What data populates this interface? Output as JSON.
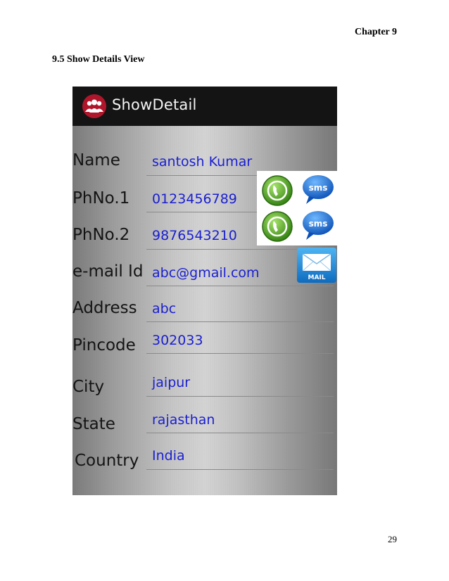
{
  "header": {
    "chapter": "Chapter 9",
    "section": "9.5 Show Details View"
  },
  "footer": {
    "page_number": "29"
  },
  "app": {
    "title": "ShowDetail",
    "fields": [
      {
        "label": "Name",
        "value": "santosh Kumar"
      },
      {
        "label": "PhNo.1",
        "value": "0123456789"
      },
      {
        "label": "PhNo.2",
        "value": "9876543210"
      },
      {
        "label": "e-mail Id",
        "value": "abc@gmail.com"
      },
      {
        "label": "Address",
        "value": "abc"
      },
      {
        "label": "Pincode",
        "value": "302033"
      },
      {
        "label": "City",
        "value": "jaipur"
      },
      {
        "label": "State",
        "value": "rajasthan"
      },
      {
        "label": "Country",
        "value": "India"
      }
    ],
    "actions": {
      "sms_label": "sms",
      "mail_label": "MAIL"
    }
  },
  "colors": {
    "action_bar": "#141414",
    "value_text": "#1a1fd0",
    "call_green": "#4aa31c",
    "sms_blue": "#1273d6",
    "mail_blue": "#1f8fdb",
    "app_icon_red": "#b0162b"
  },
  "icons": [
    "app-users-icon",
    "call-icon",
    "sms-icon",
    "mail-icon"
  ]
}
